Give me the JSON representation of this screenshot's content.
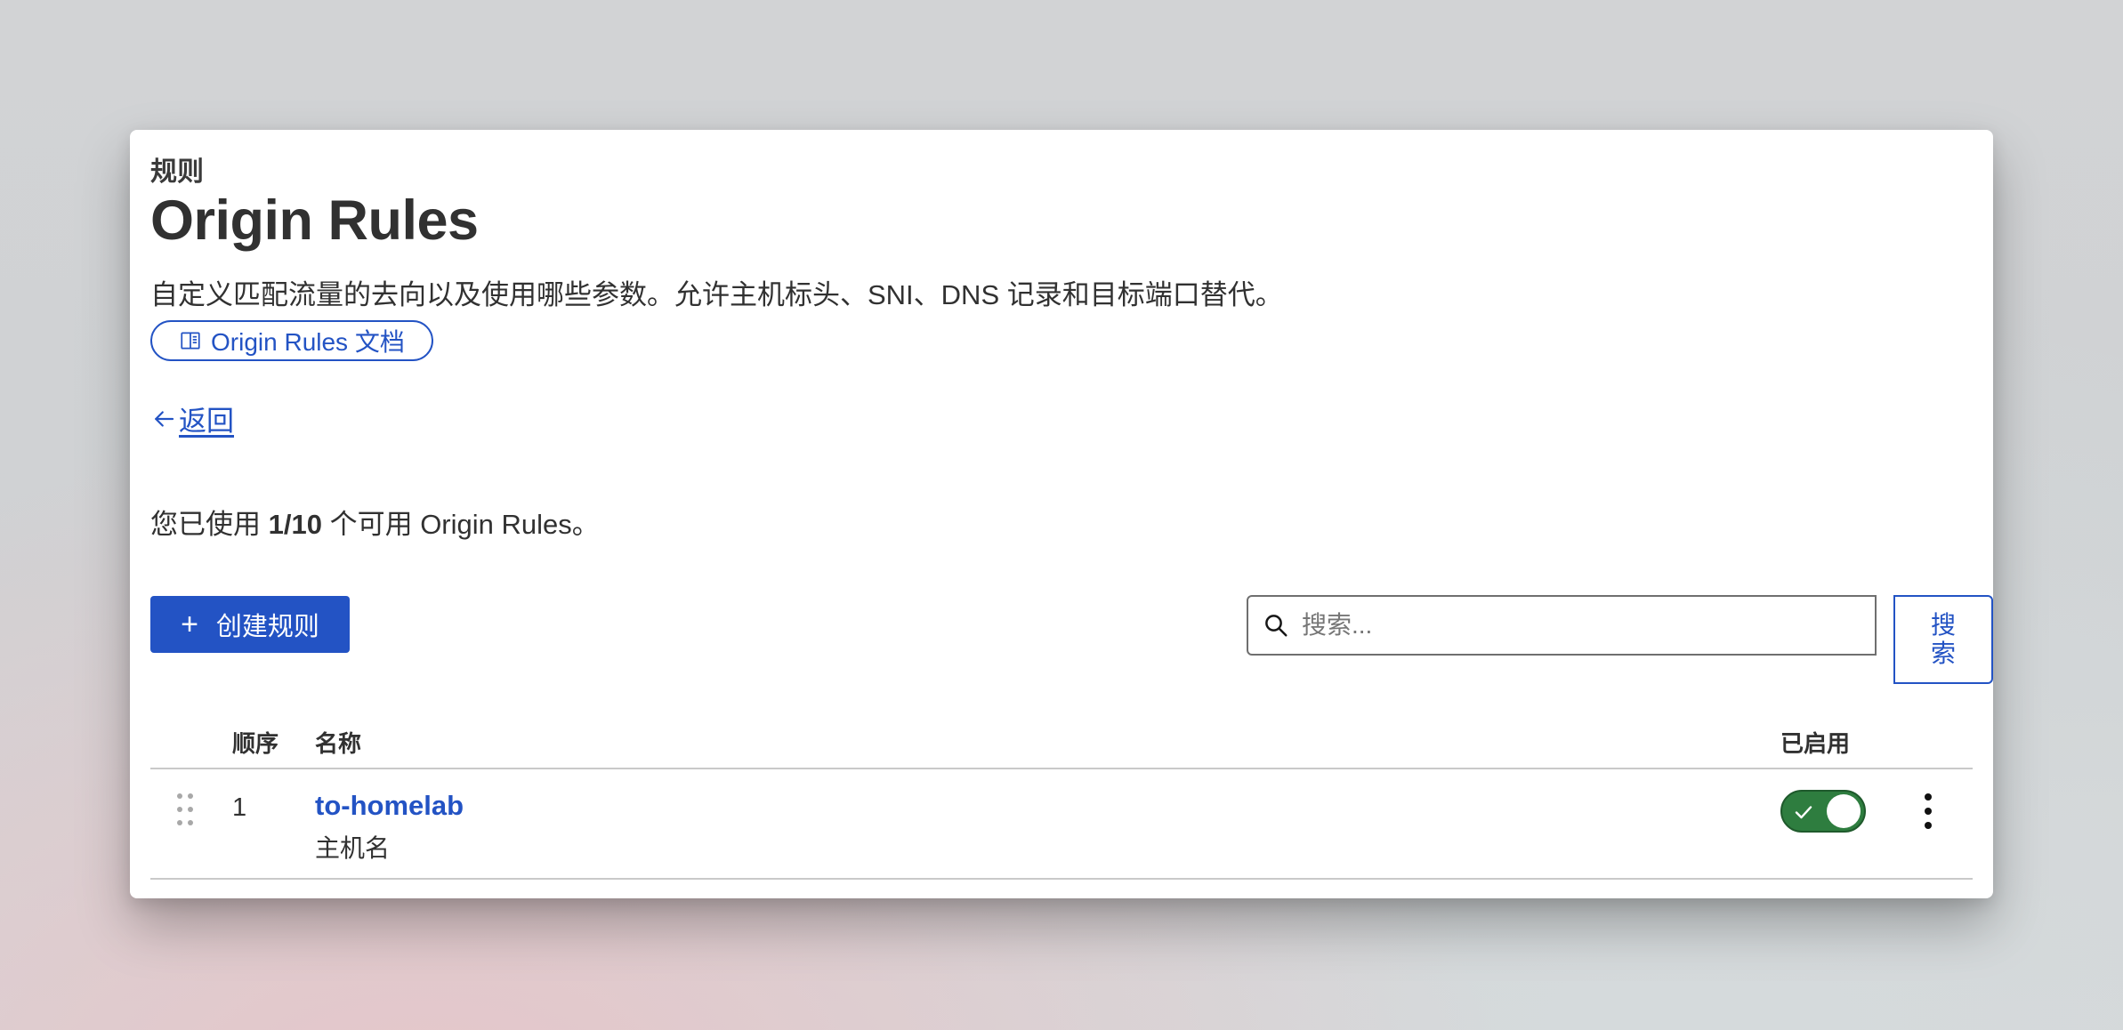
{
  "header": {
    "eyebrow": "规则",
    "title": "Origin Rules",
    "description": "自定义匹配流量的去向以及使用哪些参数。允许主机标头、SNI、DNS 记录和目标端口替代。",
    "docs_link_label": "Origin Rules 文档"
  },
  "nav": {
    "back_label": "返回"
  },
  "usage": {
    "prefix": "您已使用 ",
    "count": "1/10",
    "suffix": " 个可用 Origin Rules。"
  },
  "toolbar": {
    "create_label": "创建规则",
    "search_placeholder": "搜索...",
    "search_button_label": "搜索"
  },
  "table": {
    "columns": {
      "order": "顺序",
      "name": "名称",
      "enabled": "已启用"
    },
    "rows": [
      {
        "order": "1",
        "name": "to-homelab",
        "description": "主机名",
        "enabled": true
      }
    ]
  },
  "colors": {
    "accent": "#2353c4",
    "toggle_on": "#2e7d3f"
  },
  "icons": {
    "docs": "book-icon",
    "back": "arrow-left-icon",
    "create": "plus-icon",
    "search": "search-icon",
    "drag": "drag-handle-icon",
    "toggle": "check-icon",
    "menu": "kebab-menu-icon"
  }
}
